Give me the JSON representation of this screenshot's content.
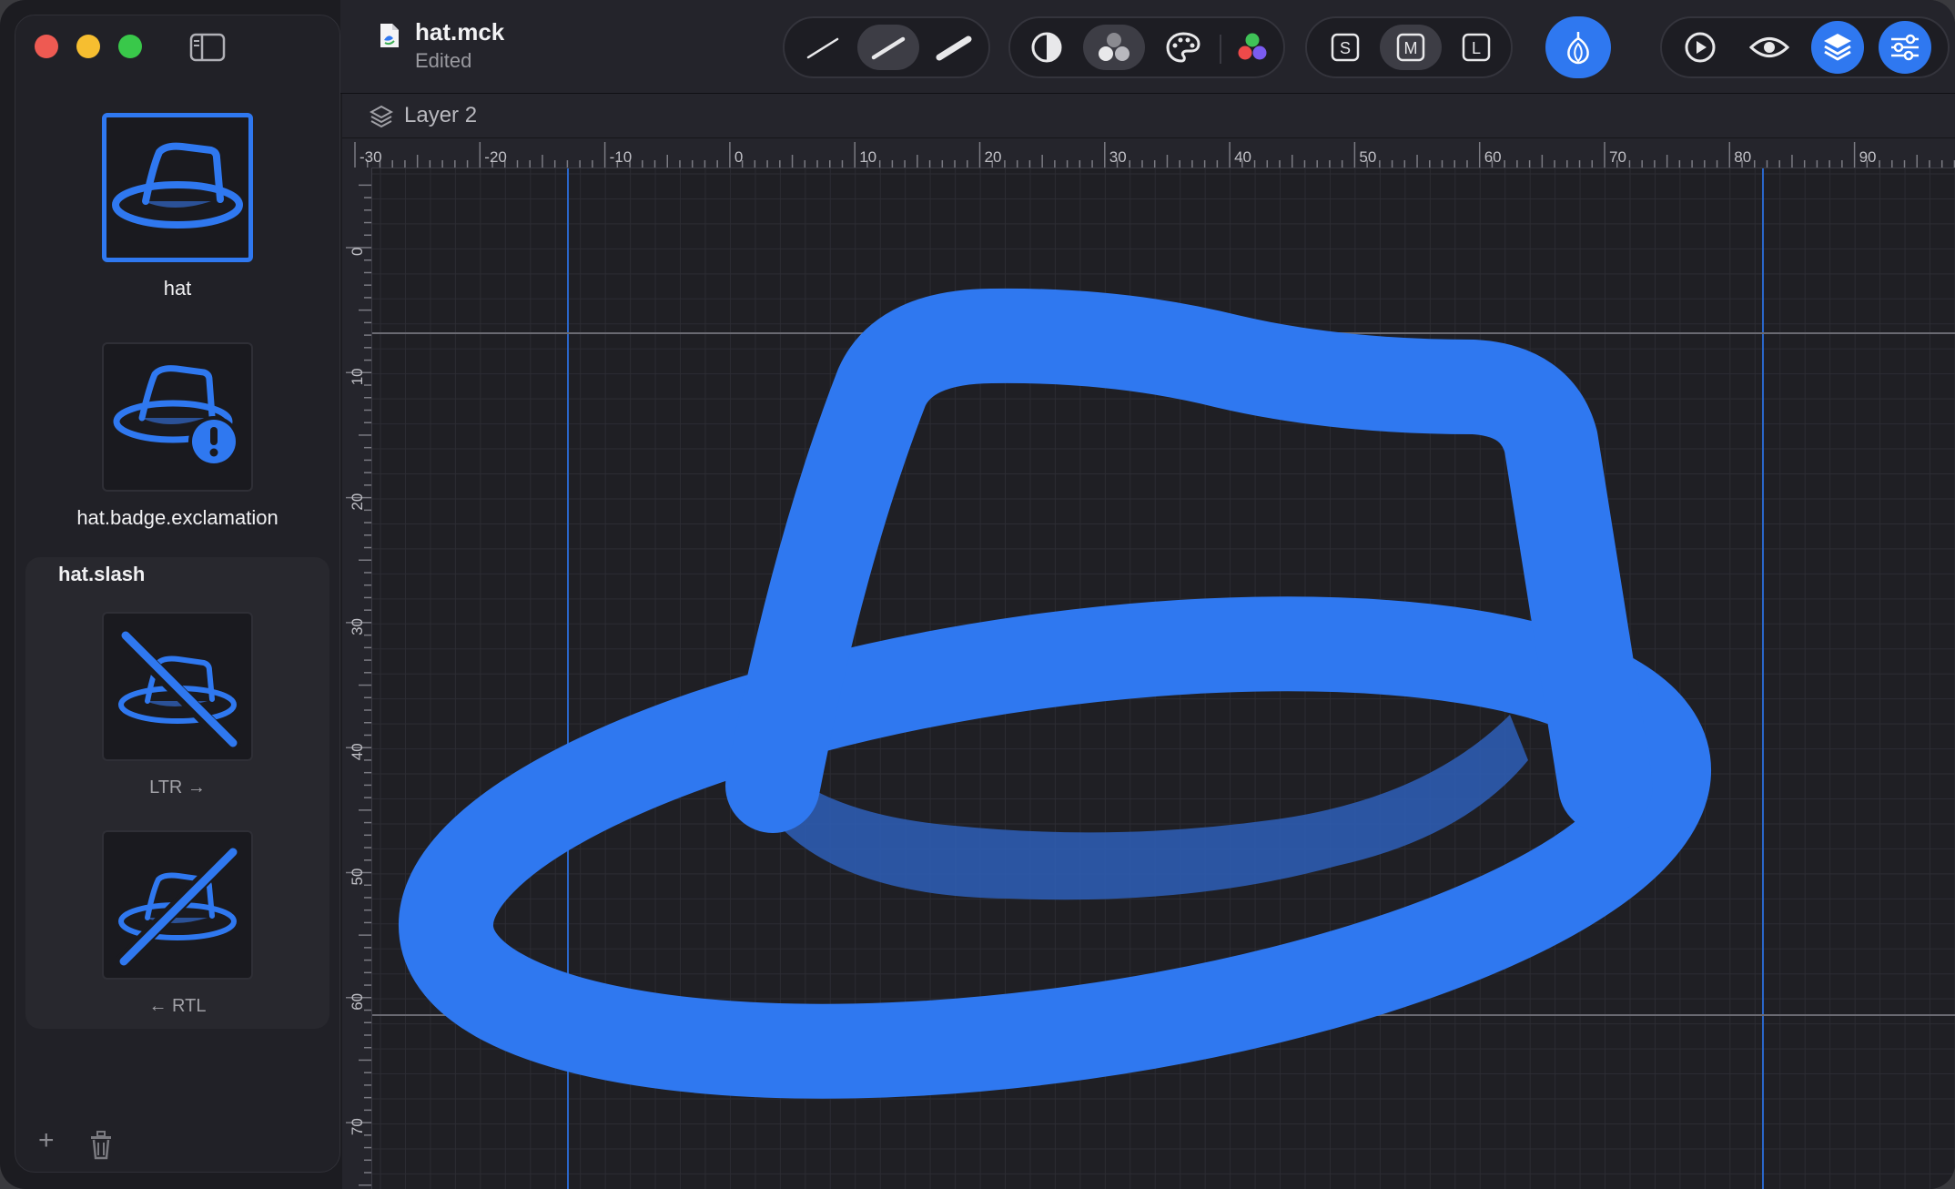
{
  "window": {
    "traffic_lights": {
      "close": "#ee5a52",
      "minimize": "#f6be30",
      "zoom": "#39c84a"
    }
  },
  "document": {
    "title": "hat.mck",
    "subtitle": "Edited"
  },
  "toolbar": {
    "stroke_weights": [
      "thin-stroke-icon",
      "regular-stroke-icon",
      "bold-stroke-icon"
    ],
    "selected_stroke": "regular",
    "rendering_modes": [
      "monochrome-icon",
      "hierarchical-icon",
      "palette-icon",
      "multicolor-icon"
    ],
    "selected_rendering": "hierarchical",
    "sizes": [
      "S",
      "M",
      "L"
    ],
    "selected_size": "M",
    "actions": [
      "variable-icon",
      "play-icon",
      "preview-eye-icon",
      "layers-icon",
      "inspector-icon"
    ],
    "accent": "#2f78f0"
  },
  "sidebar": {
    "symbols": [
      {
        "label": "hat",
        "selected": true
      },
      {
        "label": "hat.badge.exclamation",
        "selected": false
      }
    ],
    "group": {
      "title": "hat.slash",
      "variants": [
        {
          "label": "LTR →"
        },
        {
          "label": "← RTL"
        }
      ]
    },
    "footer": {
      "add": "+",
      "delete": "trash-icon"
    }
  },
  "layer": {
    "name": "Layer 2"
  },
  "rulers": {
    "horizontal_labels": [
      "-30",
      "-20",
      "-10",
      "0",
      "10",
      "20",
      "30",
      "40",
      "50",
      "60",
      "70",
      "80",
      "90"
    ],
    "vertical_labels": [
      "0",
      "10",
      "20",
      "30",
      "40",
      "50",
      "60",
      "70"
    ]
  },
  "canvas": {
    "symbol_color": "#2f78f0",
    "secondary_color": "#3160b8",
    "grid_color": "#2c2c33",
    "guide_color": "#2a66c9"
  }
}
